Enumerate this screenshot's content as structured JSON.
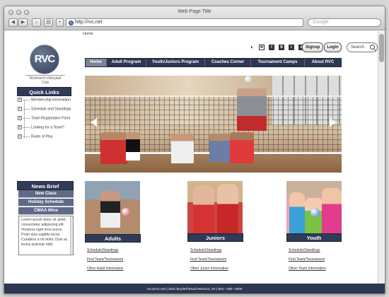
{
  "browser": {
    "window_title": "Web Page Title",
    "url": "http://rvc.net",
    "search_placeholder": "Google",
    "back_label": "◀",
    "forward_label": "▶",
    "home_label": "⌂",
    "print_label": "▤",
    "add_label": "+"
  },
  "breadcrumb": "Home",
  "logo": {
    "initials": "RVC",
    "caption": "Richmond Volleyball Club"
  },
  "header": {
    "social_icons": [
      "rss-icon",
      "mail-icon",
      "facebook-icon",
      "blog-icon",
      "twitter-icon",
      "delicious-icon"
    ],
    "signup_label": "Signup",
    "login_label": "Login",
    "search_label": "Search"
  },
  "main_nav": [
    {
      "label": "Home",
      "active": true
    },
    {
      "label": "Adult Program",
      "active": false
    },
    {
      "label": "Youth/Juniors Program",
      "active": false
    },
    {
      "label": "Coaches Corner",
      "active": false
    },
    {
      "label": "Tournament Camps",
      "active": false
    },
    {
      "label": "About RVC",
      "active": false
    }
  ],
  "quick_links": {
    "title": "Quick Links",
    "items": [
      {
        "label": "Membership Information"
      },
      {
        "label": "Schedule and Standings"
      },
      {
        "label": "Team Registration Form"
      },
      {
        "label": "Looking for a Team?"
      },
      {
        "label": "Rules of Play"
      }
    ]
  },
  "news_brief": {
    "title": "News Brief",
    "items": [
      "New Class",
      "Holiday Schedule",
      "CWAA Wins"
    ],
    "body": "Lorem ipsum dolor sit amet, consectetur adipiscing elit. Vivamus eget eros purus. Proin quis sagittis lacus. Curabitur a mi dolor. Duis ac lectus pulvinar nibh."
  },
  "programs": [
    {
      "label": "Adults",
      "links": [
        "Schedule/Standings",
        "Find Team/Tournament",
        "Other Adult Information"
      ]
    },
    {
      "label": "Juniors",
      "links": [
        "Schedule/Standings",
        "Find Team/Tournament",
        "Other Junior Information"
      ]
    },
    {
      "label": "Youth",
      "links": [
        "Schedule/Standings",
        "Find Team/Tournament",
        "Other Youth Information"
      ]
    }
  ],
  "footer": "rvc@rvc.net  |  2521 Brydell Road Henrico, VA  |  804 • 268 • 3000",
  "colors": {
    "nav_bg": "#2c3752",
    "nav_active": "#7b8296",
    "news_row_bg": "#5f6a87"
  }
}
